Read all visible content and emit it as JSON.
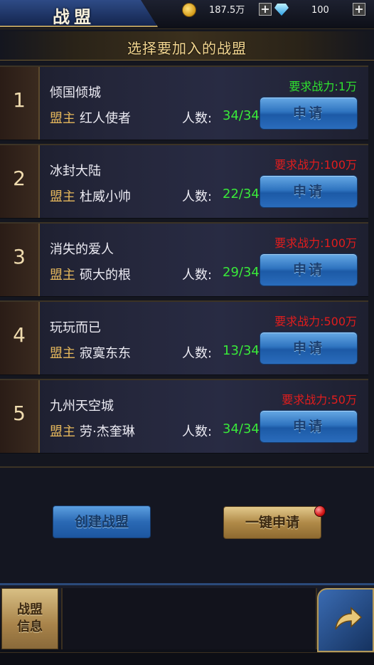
{
  "header": {
    "title": "战盟",
    "gold_amount": "187.5万",
    "gem_amount": "100",
    "plus_symbol": "+",
    "icons": {
      "gold": "gold-coin-icon",
      "gem": "diamond-icon"
    }
  },
  "section_title": "选择要加入的战盟",
  "labels": {
    "leader": "盟主",
    "members": "人数:",
    "apply": "申请"
  },
  "guilds": [
    {
      "rank": "1",
      "name": "倾国倾城",
      "leader": "红人使者",
      "members": "34/34",
      "requirement": "要求战力:1万",
      "req_color": "#2fe32f"
    },
    {
      "rank": "2",
      "name": "冰封大陆",
      "leader": "杜威小帅",
      "members": "22/34",
      "requirement": "要求战力:100万",
      "req_color": "#e11d1d"
    },
    {
      "rank": "3",
      "name": "消失的爱人",
      "leader": "硕大的根",
      "members": "29/34",
      "requirement": "要求战力:100万",
      "req_color": "#e11d1d"
    },
    {
      "rank": "4",
      "name": "玩玩而已",
      "leader": "寂寞东东",
      "members": "13/34",
      "requirement": "要求战力:500万",
      "req_color": "#e11d1d"
    },
    {
      "rank": "5",
      "name": "九州天空城",
      "leader": "劳·杰奎琳",
      "members": "34/34",
      "requirement": "要求战力:50万",
      "req_color": "#e11d1d"
    }
  ],
  "actions": {
    "create": "创建战盟",
    "quick_apply": "一键申请"
  },
  "footer": {
    "info_line1": "战盟",
    "info_line2": "信息",
    "back_icon": "return-arrow-icon"
  },
  "colors": {
    "gold_text": "#f3d690",
    "member_green": "#39e93a",
    "button_blue": "#2f74c0",
    "button_gold": "#b08a48"
  }
}
